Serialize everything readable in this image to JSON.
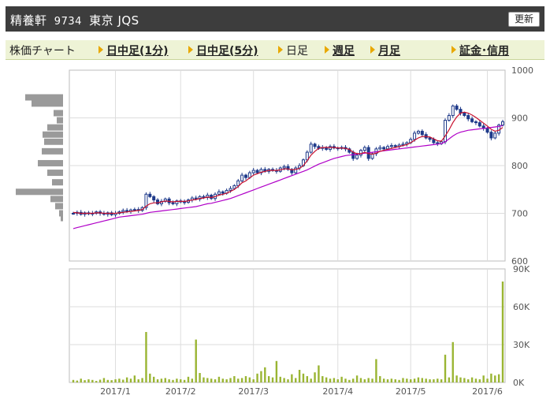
{
  "header": {
    "name": "精養軒",
    "code": "9734",
    "market": "東京 JQS",
    "refresh_label": "更新"
  },
  "nav": {
    "label": "株価チャート",
    "intraday1": "日中足(1分)",
    "intraday5": "日中足(5分)",
    "daily": "日足",
    "weekly": "週足",
    "monthly": "月足",
    "margin": "証金･信用"
  },
  "colors": {
    "candle": "#1f3a8a",
    "ma_short": "#c8102e",
    "ma_long": "#b000c8",
    "volume": "#9ab533",
    "profile": "#9a9a9a",
    "grid": "#dddddd"
  },
  "chart_data": [
    {
      "type": "candlestick",
      "ylim": [
        600,
        1000
      ],
      "yticks": [
        "600",
        "700",
        "800",
        "900",
        "1000"
      ],
      "xticks": [
        "2017/1",
        "2017/2",
        "2017/3",
        "2017/4",
        "2017/5",
        "2017/6"
      ],
      "close": [
        700,
        702,
        698,
        701,
        699,
        700,
        703,
        700,
        698,
        701,
        697,
        700,
        703,
        706,
        704,
        707,
        708,
        706,
        712,
        740,
        735,
        728,
        720,
        725,
        730,
        722,
        720,
        726,
        724,
        723,
        728,
        732,
        730,
        735,
        733,
        738,
        731,
        740,
        745,
        742,
        748,
        752,
        758,
        768,
        780,
        775,
        785,
        790,
        785,
        792,
        788,
        792,
        790,
        788,
        795,
        798,
        792,
        785,
        795,
        800,
        812,
        828,
        845,
        840,
        836,
        838,
        834,
        840,
        837,
        836,
        838,
        835,
        828,
        815,
        822,
        832,
        838,
        815,
        825,
        835,
        838,
        835,
        840,
        842,
        840,
        843,
        845,
        848,
        855,
        868,
        872,
        865,
        858,
        855,
        848,
        846,
        850,
        895,
        905,
        925,
        918,
        910,
        905,
        898,
        892,
        890,
        883,
        878,
        870,
        858,
        868,
        885,
        892
      ],
      "ma_short": [
        702,
        701,
        700,
        700,
        700,
        700,
        701,
        701,
        700,
        700,
        700,
        700,
        701,
        702,
        703,
        704,
        705,
        706,
        708,
        715,
        720,
        722,
        722,
        724,
        726,
        725,
        724,
        725,
        725,
        725,
        726,
        728,
        729,
        731,
        732,
        734,
        733,
        735,
        738,
        740,
        742,
        746,
        750,
        756,
        764,
        768,
        774,
        780,
        783,
        786,
        788,
        790,
        790,
        790,
        791,
        793,
        793,
        791,
        792,
        794,
        800,
        810,
        822,
        830,
        836,
        838,
        838,
        838,
        838,
        837,
        837,
        836,
        834,
        828,
        825,
        825,
        828,
        825,
        824,
        826,
        830,
        832,
        834,
        836,
        838,
        840,
        842,
        844,
        848,
        853,
        858,
        861,
        861,
        860,
        856,
        852,
        851,
        862,
        875,
        890,
        902,
        910,
        912,
        910,
        906,
        901,
        895,
        889,
        883,
        876,
        872,
        874,
        880
      ],
      "ma_long": [
        668,
        670,
        672,
        674,
        676,
        678,
        680,
        682,
        684,
        686,
        688,
        690,
        692,
        693,
        694,
        695,
        696,
        697,
        698,
        700,
        702,
        703,
        704,
        705,
        706,
        707,
        708,
        709,
        710,
        711,
        712,
        713,
        714,
        716,
        718,
        720,
        721,
        723,
        725,
        727,
        729,
        731,
        734,
        737,
        740,
        743,
        746,
        749,
        752,
        755,
        758,
        761,
        764,
        767,
        770,
        773,
        776,
        779,
        782,
        785,
        788,
        791,
        795,
        799,
        803,
        806,
        809,
        812,
        815,
        817,
        819,
        821,
        822,
        823,
        824,
        825,
        826,
        827,
        828,
        829,
        830,
        831,
        832,
        833,
        834,
        835,
        836,
        837,
        838,
        839,
        840,
        841,
        842,
        843,
        844,
        845,
        846,
        850,
        856,
        862,
        867,
        870,
        872,
        874,
        875,
        876,
        877,
        878,
        879,
        880,
        881,
        882,
        884
      ],
      "volume_ylim": [
        0,
        90000
      ],
      "volume_yticks": [
        "0K",
        "30K",
        "60K",
        "90K"
      ],
      "volume": [
        2000,
        1500,
        3000,
        1800,
        2500,
        2000,
        1200,
        2200,
        3500,
        2000,
        1800,
        2500,
        3000,
        2200,
        4000,
        3000,
        5500,
        2500,
        3500,
        40000,
        7000,
        4500,
        2500,
        3000,
        3500,
        2500,
        2000,
        3000,
        2500,
        2000,
        4500,
        3000,
        34000,
        7500,
        4000,
        3500,
        3000,
        2500,
        4500,
        3000,
        2500,
        3500,
        5000,
        3000,
        3500,
        5000,
        4000,
        2500,
        7000,
        9000,
        12000,
        5000,
        4000,
        17000,
        4500,
        3500,
        2500,
        6500,
        3500,
        10000,
        7000,
        5000,
        3000,
        8000,
        13500,
        5000,
        4000,
        3000,
        3500,
        2500,
        4500,
        3000,
        2000,
        3000,
        5500,
        3500,
        2500,
        3500,
        3000,
        18500,
        5000,
        3000,
        2500,
        3000,
        2500,
        2000,
        3500,
        3000,
        2500,
        3000,
        4000,
        3500,
        3000,
        2500,
        2500,
        3000,
        2500,
        22000,
        4000,
        32000,
        5500,
        4000,
        3500,
        2500,
        4000,
        3000,
        2500,
        5500,
        3000,
        7000,
        5500,
        6500,
        80000
      ],
      "price_profile": [
        {
          "price": 943,
          "size": 48
        },
        {
          "price": 930,
          "size": 40
        },
        {
          "price": 910,
          "size": 12
        },
        {
          "price": 895,
          "size": 8
        },
        {
          "price": 880,
          "size": 20
        },
        {
          "price": 865,
          "size": 26
        },
        {
          "price": 850,
          "size": 24
        },
        {
          "price": 830,
          "size": 27
        },
        {
          "price": 805,
          "size": 32
        },
        {
          "price": 785,
          "size": 20
        },
        {
          "price": 765,
          "size": 14
        },
        {
          "price": 745,
          "size": 60
        },
        {
          "price": 730,
          "size": 16
        },
        {
          "price": 715,
          "size": 10
        },
        {
          "price": 700,
          "size": 5
        },
        {
          "price": 690,
          "size": 3
        }
      ]
    }
  ]
}
